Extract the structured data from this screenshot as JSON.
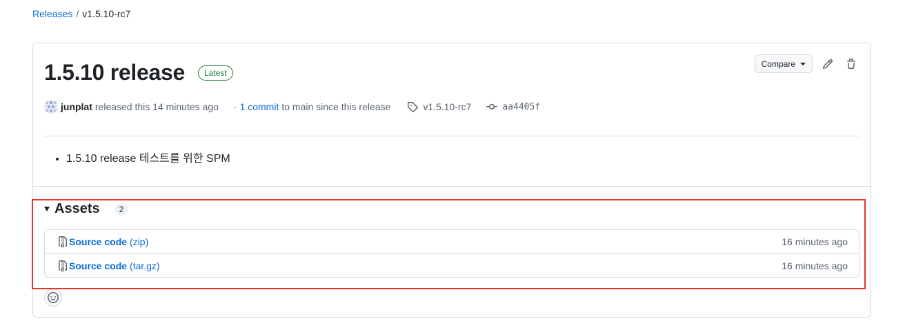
{
  "breadcrumb": {
    "root": "Releases",
    "separator": "/",
    "current": "v1.5.10-rc7"
  },
  "release": {
    "title": "1.5.10 release",
    "badge": "Latest",
    "actions": {
      "compare_label": "Compare",
      "edit_icon": "pencil-icon",
      "delete_icon": "trash-icon"
    },
    "meta": {
      "author": "junplat",
      "released_text": "released this 14 minutes ago",
      "dot": "·",
      "commit_link": "1 commit",
      "commit_suffix": "to main since this release",
      "tag": "v1.5.10-rc7",
      "commit_sha": "aa4405f"
    },
    "notes": [
      "1.5.10 release 테스트를 위한 SPM"
    ]
  },
  "assets": {
    "title": "Assets",
    "count": "2",
    "items": [
      {
        "name": "Source code",
        "ext": "(zip)",
        "time": "16 minutes ago"
      },
      {
        "name": "Source code",
        "ext": "(tar.gz)",
        "time": "16 minutes ago"
      }
    ]
  },
  "colors": {
    "link": "#0969da",
    "latest": "#1a7f37",
    "border": "#d1d9e0",
    "highlight": "#e5322d"
  }
}
